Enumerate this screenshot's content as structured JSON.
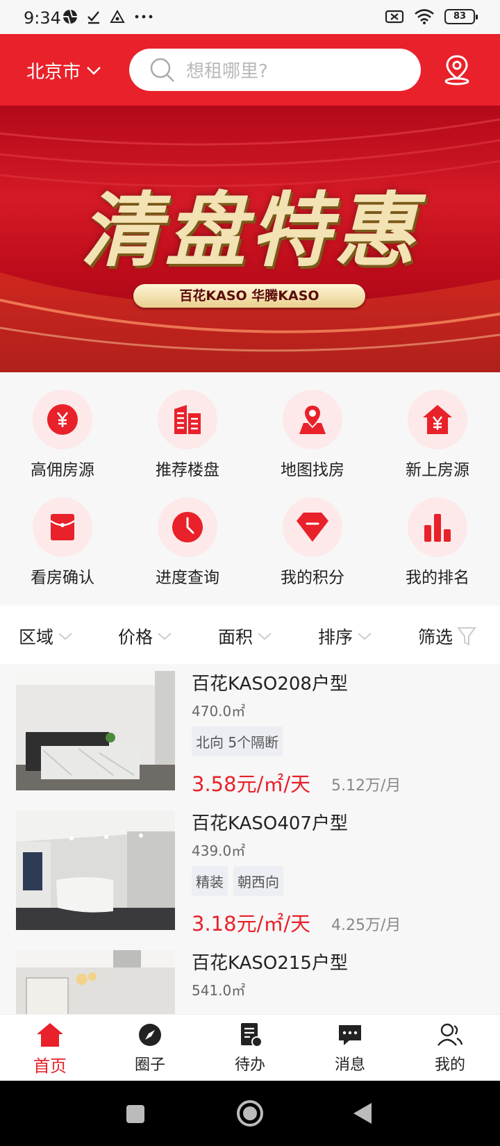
{
  "status_bar": {
    "time": "9:34",
    "battery": "83"
  },
  "header": {
    "city": "北京市",
    "search_placeholder": "想租哪里?"
  },
  "banner": {
    "title": "清盘特惠",
    "subtitle": "百花KASO 华腾KASO"
  },
  "quick_links": [
    {
      "label": "高佣房源",
      "icon": "yen-coin-icon"
    },
    {
      "label": "推荐楼盘",
      "icon": "buildings-icon"
    },
    {
      "label": "地图找房",
      "icon": "map-pin-icon"
    },
    {
      "label": "新上房源",
      "icon": "house-yen-icon"
    },
    {
      "label": "看房确认",
      "icon": "envelope-icon"
    },
    {
      "label": "进度查询",
      "icon": "clock-icon"
    },
    {
      "label": "我的积分",
      "icon": "diamond-icon"
    },
    {
      "label": "我的排名",
      "icon": "bar-chart-icon"
    }
  ],
  "filters": [
    "区域",
    "价格",
    "面积",
    "排序",
    "筛选"
  ],
  "listings": [
    {
      "title": "百花KASO208户型",
      "area": "470.0㎡",
      "tags": [
        "北向 5个隔断"
      ],
      "price": "3.58元/㎡/天",
      "monthly": "5.12万/月"
    },
    {
      "title": "百花KASO407户型",
      "area": "439.0㎡",
      "tags": [
        "精装",
        "朝西向"
      ],
      "price": "3.18元/㎡/天",
      "monthly": "4.25万/月"
    },
    {
      "title": "百花KASO215户型",
      "area": "541.0㎡",
      "tags": [],
      "price": "",
      "monthly": ""
    }
  ],
  "bottom_nav": [
    {
      "label": "首页",
      "active": true
    },
    {
      "label": "圈子",
      "active": false
    },
    {
      "label": "待办",
      "active": false
    },
    {
      "label": "消息",
      "active": false
    },
    {
      "label": "我的",
      "active": false
    }
  ],
  "colors": {
    "brand_red": "#e8212a",
    "icon_bg": "#fde9e9"
  }
}
